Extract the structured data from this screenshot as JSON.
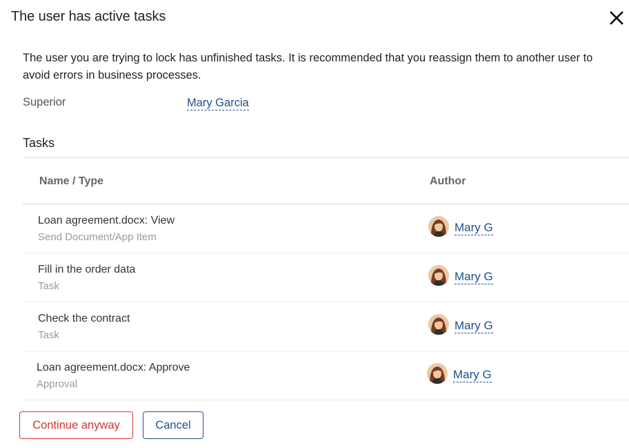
{
  "dialog": {
    "title": "The user has active tasks",
    "close_icon": "close-icon",
    "message": "The user you are trying to lock has unfinished tasks. It is recommended that you reassign them to another user to avoid errors in business processes.",
    "superior_label": "Superior",
    "superior_name": "Mary Garcia"
  },
  "tasks": {
    "heading": "Tasks",
    "columns": {
      "name_type": "Name / Type",
      "author": "Author"
    },
    "rows": [
      {
        "name": "Loan agreement.docx: View",
        "type": "Send Document/App Item",
        "author": "Mary G"
      },
      {
        "name": "Fill in the order data",
        "type": "Task",
        "author": "Mary G"
      },
      {
        "name": "Check the contract",
        "type": "Task",
        "author": "Mary G"
      },
      {
        "name": "Loan agreement.docx: Approve",
        "type": "Approval",
        "author": "Mary G"
      }
    ]
  },
  "buttons": {
    "continue_label": "Continue anyway",
    "cancel_label": "Cancel"
  },
  "colors": {
    "link": "#1e4f8c",
    "danger": "#d0342c",
    "muted_text": "#9a9a9a"
  }
}
